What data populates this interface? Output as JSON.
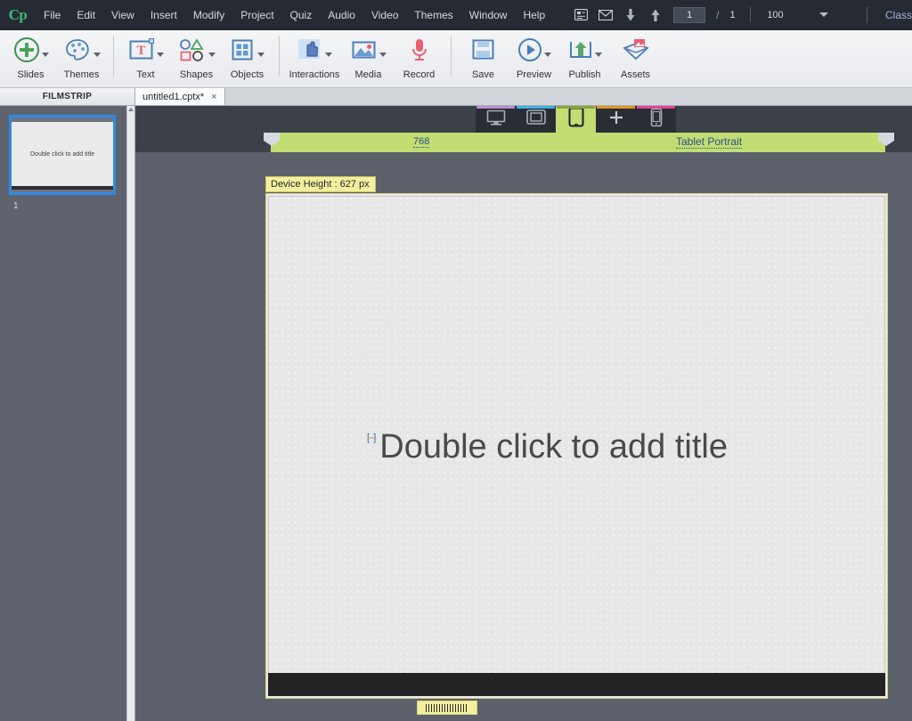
{
  "app": {
    "logo": "Cp",
    "menu": [
      "File",
      "Edit",
      "View",
      "Insert",
      "Modify",
      "Project",
      "Quiz",
      "Audio",
      "Video",
      "Themes",
      "Window",
      "Help"
    ],
    "right_label": "Class"
  },
  "menu_tools": {
    "icons": [
      "slide-properties-icon",
      "email-icon",
      "down-arrow-icon",
      "up-arrow-icon"
    ],
    "page_current": "1",
    "page_separator": "/",
    "page_total": "1",
    "zoom_value": "100",
    "zoom_caret": "dropdown-caret"
  },
  "ribbon": {
    "groups": [
      {
        "buttons": [
          {
            "label": "Slides",
            "icon": "plus-circle-icon",
            "caret": true
          },
          {
            "label": "Themes",
            "icon": "palette-icon",
            "caret": true
          }
        ]
      },
      {
        "buttons": [
          {
            "label": "Text",
            "icon": "text-box-icon",
            "caret": true
          },
          {
            "label": "Shapes",
            "icon": "shapes-icon",
            "caret": true
          },
          {
            "label": "Objects",
            "icon": "objects-grid-icon",
            "caret": true
          }
        ]
      },
      {
        "buttons": [
          {
            "label": "Interactions",
            "icon": "hand-pointer-icon",
            "caret": true
          },
          {
            "label": "Media",
            "icon": "image-icon",
            "caret": true
          },
          {
            "label": "Record",
            "icon": "microphone-icon",
            "caret": false
          }
        ]
      },
      {
        "buttons": [
          {
            "label": "Save",
            "icon": "floppy-disk-icon",
            "caret": false
          },
          {
            "label": "Preview",
            "icon": "play-circle-icon",
            "caret": true
          },
          {
            "label": "Publish",
            "icon": "upload-box-icon",
            "caret": true
          },
          {
            "label": "Assets",
            "icon": "assets-box-icon",
            "caret": false
          }
        ]
      }
    ]
  },
  "filmstrip": {
    "header": "FILMSTRIP",
    "slides": [
      {
        "number": "1",
        "text": "Double click to add title"
      }
    ]
  },
  "tabs": {
    "documents": [
      {
        "name": "untitled1.cptx*",
        "close": "×"
      }
    ]
  },
  "stage": {
    "devices": [
      {
        "name": "desktop-device-button",
        "accent": "#b48fd4",
        "active": false,
        "icon": "monitor-icon"
      },
      {
        "name": "tablet-landscape-device-button",
        "accent": "#3ab0e0",
        "active": false,
        "icon": "tablet-landscape-icon"
      },
      {
        "name": "tablet-portrait-device-button",
        "accent": "#8aa33f",
        "active": true,
        "icon": "tablet-portrait-icon"
      },
      {
        "name": "add-device-button",
        "accent": "#e39326",
        "active": false,
        "icon": "plus-icon"
      },
      {
        "name": "mobile-device-button",
        "accent": "#e2439a",
        "active": false,
        "icon": "phone-icon"
      }
    ],
    "breakpoint_width": "768",
    "breakpoint_name": "Tablet Portrait",
    "device_height_label": "Device Height : 627 px",
    "slide_title_placeholder": "Double click to add title",
    "placeholder_marker": "[–]"
  },
  "colors": {
    "menubar_bg": "#262b33",
    "ribbon_bg": "#f2f3f6",
    "stage_bg": "#5c616b",
    "breakpoint_green": "#c2dd72",
    "badge_yellow": "#f5f0a0",
    "selection_blue": "#2e8ae6",
    "link_blue": "#2c4f86"
  }
}
